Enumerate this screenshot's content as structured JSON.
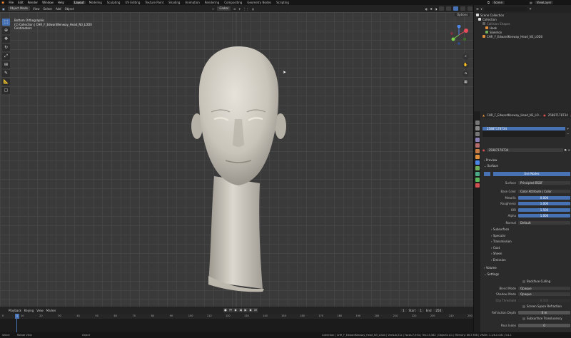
{
  "topbar": {
    "menus": [
      "File",
      "Edit",
      "Render",
      "Window",
      "Help"
    ],
    "workspaces": [
      "Layout",
      "Modeling",
      "Sculpting",
      "UV Editing",
      "Texture Paint",
      "Shading",
      "Animation",
      "Rendering",
      "Compositing",
      "Geometry Nodes",
      "Scripting"
    ],
    "active_workspace": "Layout",
    "scene": "Scene",
    "view_layer": "ViewLayer"
  },
  "viewport_header": {
    "mode": "Object Mode",
    "menus": [
      "View",
      "Select",
      "Add",
      "Object"
    ],
    "orientation": "Global",
    "options": "Options"
  },
  "viewport": {
    "view_name": "Bottom Orthographic",
    "collection_line": "(1) Collection | CHR_F_EdwardKenway_Head_N3_LOD0",
    "units": "Centimeters",
    "toolbar_icons": [
      "select-box-icon",
      "cursor-icon",
      "move-icon",
      "rotate-icon",
      "scale-icon",
      "transform-icon",
      "annotate-icon",
      "measure-icon",
      "add-cube-icon"
    ],
    "nav_icons": [
      "zoom-icon",
      "hand-pan-icon",
      "camera-icon",
      "grid-icon"
    ],
    "axis_labels": [
      "X",
      "Y",
      "Z"
    ],
    "axis_colors": {
      "x": "#e84b5a",
      "y": "#7bcd4c",
      "z": "#4c86e8"
    }
  },
  "timeline": {
    "menus": [
      "Playback",
      "Keying",
      "View",
      "Marker"
    ],
    "current_frame": "1",
    "start_label": "Start",
    "start": "1",
    "end_label": "End",
    "end": "250",
    "ticks": [
      "0",
      "10",
      "20",
      "30",
      "40",
      "50",
      "60",
      "70",
      "80",
      "90",
      "100",
      "110",
      "120",
      "130",
      "140",
      "150",
      "160",
      "170",
      "180",
      "190",
      "200",
      "210",
      "220",
      "230",
      "240",
      "250"
    ]
  },
  "statusbar": {
    "left": [
      "Select",
      "Rotate View",
      "Object"
    ],
    "info": "Collection | CHR_F_EdwardKenway_Head_N3_LOD0 | Verts:8,312 | Faces:7,934 | Tris:15,582 | Objects:1/1 | Memory: 66.5 MiB | VRAM: 1.1/8.0 GiB | 3.6.1"
  },
  "outliner": {
    "title": "Scene Collection",
    "items": [
      {
        "label": "Collection",
        "level": 1,
        "icon": "white"
      },
      {
        "label": "Collision Shapes",
        "level": 2,
        "icon": "grey"
      },
      {
        "label": "Hook",
        "level": 3,
        "icon": "orange"
      },
      {
        "label": "Skeleton",
        "level": 3,
        "icon": "green"
      },
      {
        "label": "CHR_F_EdwardKenway_Head_N3_LOD0",
        "level": 2,
        "icon": "orange"
      }
    ]
  },
  "properties": {
    "object_name": "CHR_F_EdwardKenway_Head_N3_LO...",
    "material_name_header": "25887178734",
    "slot": "25887178734",
    "material_name": "25887178734",
    "sections": {
      "preview": "Preview",
      "surface": "Surface",
      "use_nodes": "Use Nodes",
      "subsurface": "Subsurface",
      "specular": "Specular",
      "transmission": "Transmission",
      "coat": "Coat",
      "sheen": "Sheen",
      "emission": "Emission",
      "volume": "Volume",
      "settings": "Settings"
    },
    "surface_rows": [
      {
        "label": "Surface",
        "value": "Principled BSDF",
        "style": "field"
      },
      {
        "label": "Base Color",
        "value": "Color Attribute | Color",
        "style": "field"
      },
      {
        "label": "Metallic",
        "value": "0.000",
        "style": "blue"
      },
      {
        "label": "Roughness",
        "value": "1.000",
        "style": "blue"
      },
      {
        "label": "IOR",
        "value": "1.500",
        "style": "blue"
      },
      {
        "label": "Alpha",
        "value": "1.000",
        "style": "blue"
      },
      {
        "label": "Normal",
        "value": "Default",
        "style": "field"
      }
    ],
    "settings_rows": [
      {
        "label": "Blend Mode",
        "value": "Opaque"
      },
      {
        "label": "Shadow Mode",
        "value": "Opaque"
      },
      {
        "label": "Clip Threshold",
        "value": "0.500"
      },
      {
        "label": "Refraction Depth",
        "value": "0 m"
      },
      {
        "label": "Pass Index",
        "value": "0"
      }
    ],
    "checks": {
      "backface": "Backface Culling",
      "screen_space": "Screen Space Refraction",
      "subsurface_translucency": "Subsurface Translucency"
    }
  }
}
